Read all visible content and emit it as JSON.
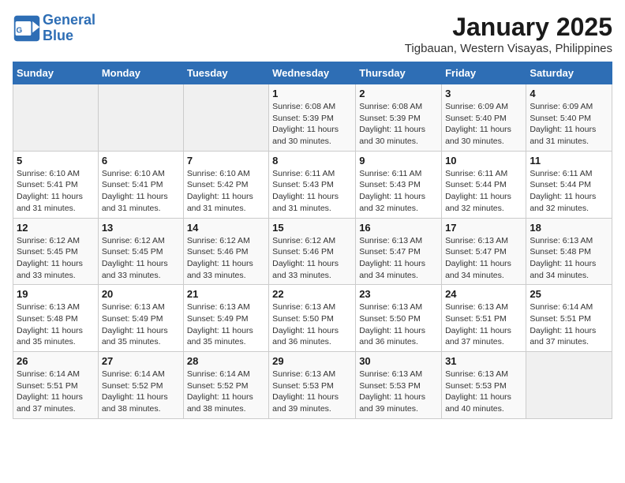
{
  "header": {
    "logo_line1": "General",
    "logo_line2": "Blue",
    "month": "January 2025",
    "location": "Tigbauan, Western Visayas, Philippines"
  },
  "days_of_week": [
    "Sunday",
    "Monday",
    "Tuesday",
    "Wednesday",
    "Thursday",
    "Friday",
    "Saturday"
  ],
  "weeks": [
    [
      {
        "day": "",
        "info": ""
      },
      {
        "day": "",
        "info": ""
      },
      {
        "day": "",
        "info": ""
      },
      {
        "day": "1",
        "info": "Sunrise: 6:08 AM\nSunset: 5:39 PM\nDaylight: 11 hours and 30 minutes."
      },
      {
        "day": "2",
        "info": "Sunrise: 6:08 AM\nSunset: 5:39 PM\nDaylight: 11 hours and 30 minutes."
      },
      {
        "day": "3",
        "info": "Sunrise: 6:09 AM\nSunset: 5:40 PM\nDaylight: 11 hours and 30 minutes."
      },
      {
        "day": "4",
        "info": "Sunrise: 6:09 AM\nSunset: 5:40 PM\nDaylight: 11 hours and 31 minutes."
      }
    ],
    [
      {
        "day": "5",
        "info": "Sunrise: 6:10 AM\nSunset: 5:41 PM\nDaylight: 11 hours and 31 minutes."
      },
      {
        "day": "6",
        "info": "Sunrise: 6:10 AM\nSunset: 5:41 PM\nDaylight: 11 hours and 31 minutes."
      },
      {
        "day": "7",
        "info": "Sunrise: 6:10 AM\nSunset: 5:42 PM\nDaylight: 11 hours and 31 minutes."
      },
      {
        "day": "8",
        "info": "Sunrise: 6:11 AM\nSunset: 5:43 PM\nDaylight: 11 hours and 31 minutes."
      },
      {
        "day": "9",
        "info": "Sunrise: 6:11 AM\nSunset: 5:43 PM\nDaylight: 11 hours and 32 minutes."
      },
      {
        "day": "10",
        "info": "Sunrise: 6:11 AM\nSunset: 5:44 PM\nDaylight: 11 hours and 32 minutes."
      },
      {
        "day": "11",
        "info": "Sunrise: 6:11 AM\nSunset: 5:44 PM\nDaylight: 11 hours and 32 minutes."
      }
    ],
    [
      {
        "day": "12",
        "info": "Sunrise: 6:12 AM\nSunset: 5:45 PM\nDaylight: 11 hours and 33 minutes."
      },
      {
        "day": "13",
        "info": "Sunrise: 6:12 AM\nSunset: 5:45 PM\nDaylight: 11 hours and 33 minutes."
      },
      {
        "day": "14",
        "info": "Sunrise: 6:12 AM\nSunset: 5:46 PM\nDaylight: 11 hours and 33 minutes."
      },
      {
        "day": "15",
        "info": "Sunrise: 6:12 AM\nSunset: 5:46 PM\nDaylight: 11 hours and 33 minutes."
      },
      {
        "day": "16",
        "info": "Sunrise: 6:13 AM\nSunset: 5:47 PM\nDaylight: 11 hours and 34 minutes."
      },
      {
        "day": "17",
        "info": "Sunrise: 6:13 AM\nSunset: 5:47 PM\nDaylight: 11 hours and 34 minutes."
      },
      {
        "day": "18",
        "info": "Sunrise: 6:13 AM\nSunset: 5:48 PM\nDaylight: 11 hours and 34 minutes."
      }
    ],
    [
      {
        "day": "19",
        "info": "Sunrise: 6:13 AM\nSunset: 5:48 PM\nDaylight: 11 hours and 35 minutes."
      },
      {
        "day": "20",
        "info": "Sunrise: 6:13 AM\nSunset: 5:49 PM\nDaylight: 11 hours and 35 minutes."
      },
      {
        "day": "21",
        "info": "Sunrise: 6:13 AM\nSunset: 5:49 PM\nDaylight: 11 hours and 35 minutes."
      },
      {
        "day": "22",
        "info": "Sunrise: 6:13 AM\nSunset: 5:50 PM\nDaylight: 11 hours and 36 minutes."
      },
      {
        "day": "23",
        "info": "Sunrise: 6:13 AM\nSunset: 5:50 PM\nDaylight: 11 hours and 36 minutes."
      },
      {
        "day": "24",
        "info": "Sunrise: 6:13 AM\nSunset: 5:51 PM\nDaylight: 11 hours and 37 minutes."
      },
      {
        "day": "25",
        "info": "Sunrise: 6:14 AM\nSunset: 5:51 PM\nDaylight: 11 hours and 37 minutes."
      }
    ],
    [
      {
        "day": "26",
        "info": "Sunrise: 6:14 AM\nSunset: 5:51 PM\nDaylight: 11 hours and 37 minutes."
      },
      {
        "day": "27",
        "info": "Sunrise: 6:14 AM\nSunset: 5:52 PM\nDaylight: 11 hours and 38 minutes."
      },
      {
        "day": "28",
        "info": "Sunrise: 6:14 AM\nSunset: 5:52 PM\nDaylight: 11 hours and 38 minutes."
      },
      {
        "day": "29",
        "info": "Sunrise: 6:13 AM\nSunset: 5:53 PM\nDaylight: 11 hours and 39 minutes."
      },
      {
        "day": "30",
        "info": "Sunrise: 6:13 AM\nSunset: 5:53 PM\nDaylight: 11 hours and 39 minutes."
      },
      {
        "day": "31",
        "info": "Sunrise: 6:13 AM\nSunset: 5:53 PM\nDaylight: 11 hours and 40 minutes."
      },
      {
        "day": "",
        "info": ""
      }
    ]
  ]
}
